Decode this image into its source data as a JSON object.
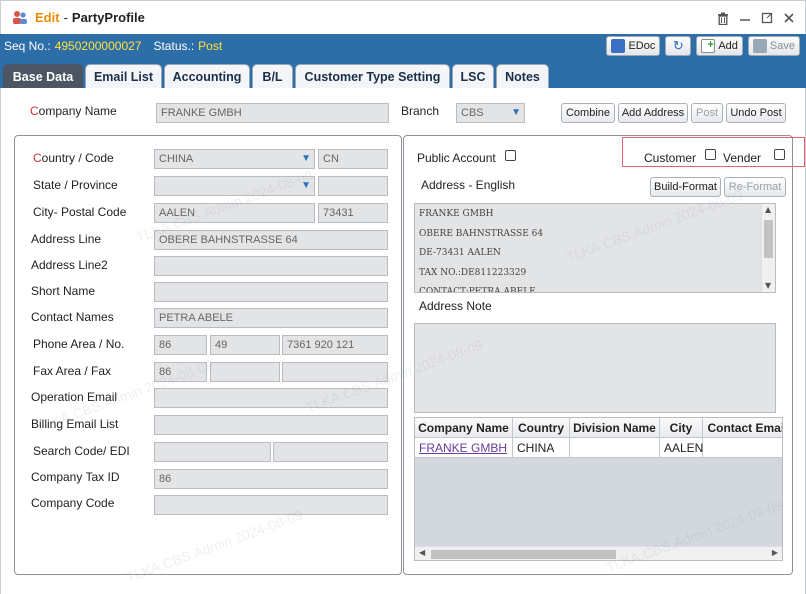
{
  "titlebar": {
    "mode": "Edit",
    "separator": "-",
    "name": "PartyProfile"
  },
  "infobar": {
    "seq_label": "Seq No.:",
    "seq_value": "4950200000027",
    "status_label": "Status.:",
    "status_value": "Post",
    "buttons": {
      "edoc": "EDoc",
      "add": "Add",
      "save": "Save"
    }
  },
  "tabs": [
    "Base Data",
    "Email List",
    "Accounting",
    "B/L",
    "Customer Type Setting",
    "LSC",
    "Notes"
  ],
  "company": {
    "label_first": "C",
    "label_rest": "ompany Name",
    "value": "FRANKE GMBH",
    "branch_label": "Branch",
    "branch_value": "CBS"
  },
  "actions": {
    "combine": "Combine",
    "add_address": "Add Address",
    "post": "Post",
    "undo_post": "Undo Post"
  },
  "left_form": {
    "country_label_first": "C",
    "country_label_rest": "ountry / Code",
    "country_value": "CHINA",
    "country_code": "CN",
    "state_label": "State / Province",
    "state_value": "",
    "state_code": "",
    "city_label": "City- Postal Code",
    "city_value": "AALEN",
    "postal_code": "73431",
    "address_label": "Address Line",
    "address_value": "OBERE BAHNSTRASSE 64",
    "address2_label": "Address Line2",
    "address2_value": "",
    "short_name_label": "Short Name",
    "short_name_value": "",
    "contact_label": "Contact Names",
    "contact_value": "PETRA ABELE",
    "phone_label": "Phone Area / No.",
    "phone_country": "86",
    "phone_area": "49",
    "phone_no": "7361 920 121",
    "fax_label": "Fax Area / Fax",
    "fax_country": "86",
    "fax_area": "",
    "fax_no": "",
    "op_email_label": "Operation Email",
    "op_email_value": "",
    "billing_email_label": "Billing Email List",
    "billing_email_value": "",
    "search_code_label": "Search Code/ EDI",
    "search_code_value": "",
    "edi_value": "",
    "tax_label": "Company Tax ID",
    "tax_value": "86",
    "company_code_label": "Company Code",
    "company_code_value": ""
  },
  "right_panel": {
    "public_account_label": "Public Account",
    "customer_label": "Customer",
    "vender_label": "Vender",
    "address_english_label": "Address - English",
    "build_format": "Build-Format",
    "re_format": "Re-Format",
    "address_lines": [
      "FRANKE GMBH",
      "OBERE BAHNSTRASSE 64",
      "DE-73431 AALEN",
      "TAX NO.:DE811223329",
      "CONTACT:PETRA ABELE"
    ],
    "address_note_label": "Address Note",
    "address_note_value": ""
  },
  "grid": {
    "columns": [
      "Company Name",
      "Country",
      "Division Name",
      "City",
      "Contact Email"
    ],
    "rows": [
      {
        "company_name": "FRANKE GMBH",
        "country": "CHINA",
        "division_name": "",
        "city": "AALEN",
        "contact_email": ""
      }
    ]
  },
  "watermark": "TLKA.CBS.Admin 2024-08-09",
  "colors": {
    "header_bar": "#2e6ea8",
    "status_value": "#ffe23a",
    "edit_mode": "#f08c00",
    "required_mark": "#d32f2f",
    "link": "#6a3b9c"
  }
}
